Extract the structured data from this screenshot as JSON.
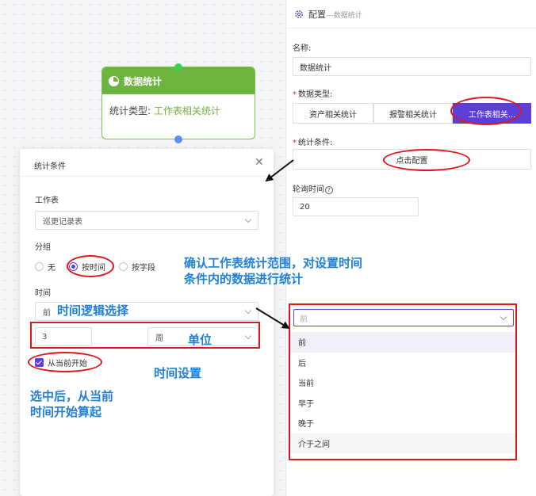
{
  "node": {
    "title": "数据统计",
    "type_label": "统计类型:",
    "type_value": "工作表相关统计"
  },
  "panel": {
    "title": "配置",
    "subtitle": "---数据统计",
    "name_label": "名称:",
    "name_value": "数据统计",
    "datatype_label": "数据类型:",
    "datatype_options": [
      "资产相关统计",
      "报警相关统计",
      "工作表相关..."
    ],
    "datatype_selected": 2,
    "condition_label": "统计条件:",
    "condition_button": "点击配置",
    "poll_label": "轮询时间",
    "poll_value": "20"
  },
  "dialog": {
    "title": "统计条件",
    "close_icon": "close-icon",
    "worksheet_label": "工作表",
    "worksheet_value": "巡更记录表",
    "group_label": "分组",
    "group_options": [
      "无",
      "按时间",
      "按字段"
    ],
    "group_selected": 1,
    "time_label": "时间",
    "time_logic_value": "前",
    "time_amount": "3",
    "time_unit": "周",
    "from_now_label": "从当前开始",
    "from_now_checked": true
  },
  "dropdown": {
    "placeholder": "前",
    "options": [
      "前",
      "后",
      "当前",
      "早于",
      "晚于",
      "介于之间"
    ]
  },
  "annotations": {
    "scope_note_line1": "确认工作表统计范围，对设置时间",
    "scope_note_line2": "条件内的数据进行统计",
    "time_logic_note": "时间逻辑选择",
    "unit_note": "单位",
    "time_setting_note": "时间设置",
    "from_now_note_line1": "选中后，从当前",
    "from_now_note_line2": "时间开始算起",
    "annotation_color": "#e0161b",
    "text_color": "#1f7fd9"
  },
  "colors": {
    "node_green": "#6db33f",
    "accent_purple": "#5b3fd6"
  }
}
